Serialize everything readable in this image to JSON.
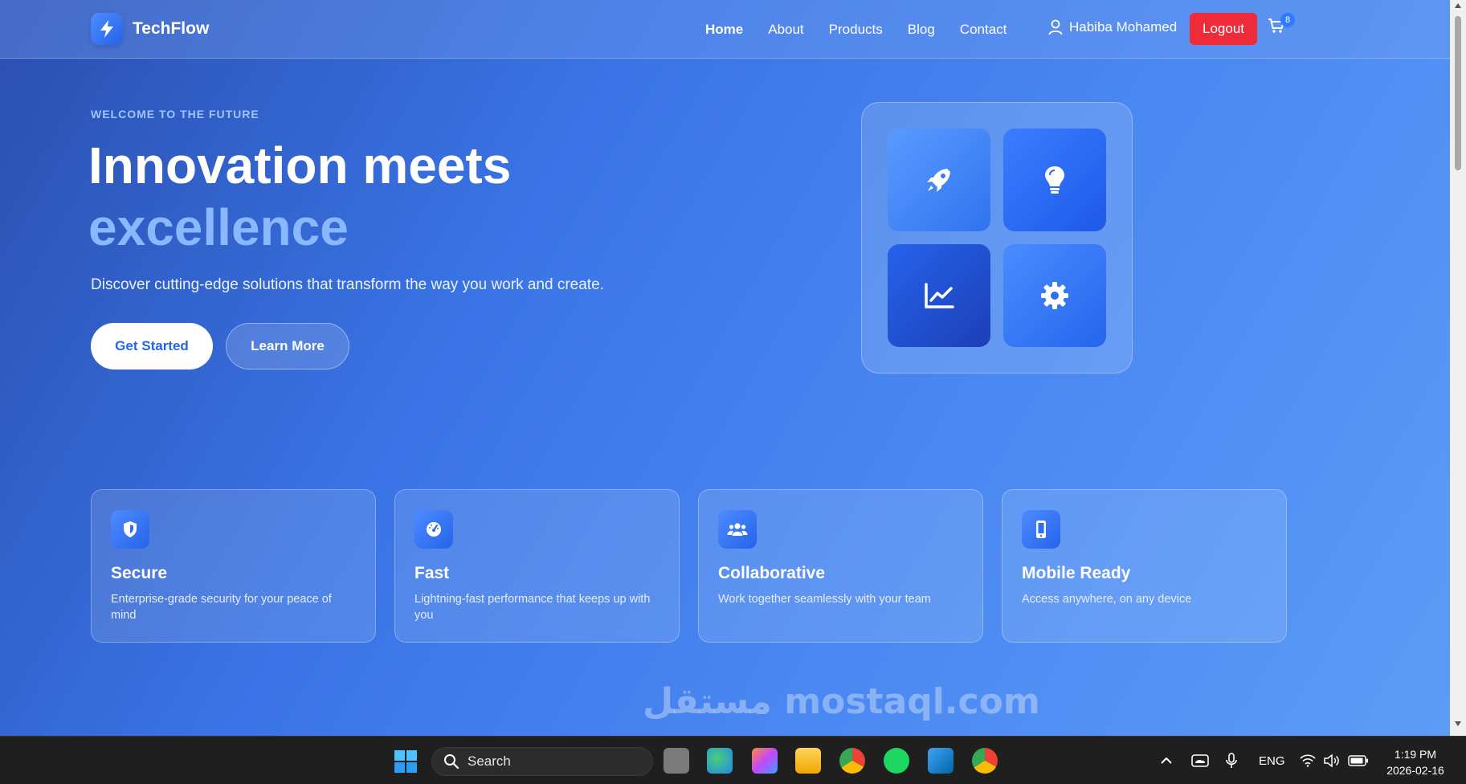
{
  "header": {
    "brand": "TechFlow",
    "nav": [
      {
        "label": "Home",
        "active": true
      },
      {
        "label": "About",
        "active": false
      },
      {
        "label": "Products",
        "active": false
      },
      {
        "label": "Blog",
        "active": false
      },
      {
        "label": "Contact",
        "active": false
      }
    ],
    "user_name": "Habiba Mohamed",
    "logout_label": "Logout",
    "cart_count": "8"
  },
  "hero": {
    "eyebrow": "WELCOME TO THE FUTURE",
    "title_line1": "Innovation meets",
    "title_line2": "excellence",
    "lead": "Discover cutting-edge solutions that transform the way you work and create.",
    "primary_cta": "Get Started",
    "secondary_cta": "Learn More",
    "tiles": [
      "rocket-icon",
      "lightbulb-icon",
      "chart-line-icon",
      "gear-icon"
    ]
  },
  "features": [
    {
      "icon": "shield-icon",
      "title": "Secure",
      "desc": "Enterprise-grade security for your peace of mind"
    },
    {
      "icon": "speedometer-icon",
      "title": "Fast",
      "desc": "Lightning-fast performance that keeps up with you"
    },
    {
      "icon": "users-icon",
      "title": "Collaborative",
      "desc": "Work together seamlessly with your team"
    },
    {
      "icon": "mobile-icon",
      "title": "Mobile Ready",
      "desc": "Access anywhere, on any device"
    }
  ],
  "taskbar": {
    "search_placeholder": "Search",
    "language": "ENG",
    "time": "1:19 PM",
    "date": "2026-02-16"
  },
  "watermark": "مستقل mostaql.com",
  "colors": {
    "accent": "#2563eb",
    "logout": "#ef2b3a",
    "highlight_text": "#8ab8ff"
  }
}
